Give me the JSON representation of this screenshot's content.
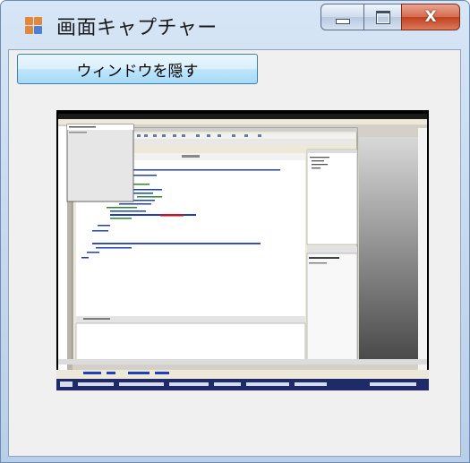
{
  "window": {
    "title": "画面キャプチャー",
    "app_icon": "app-window-icon",
    "minimize_icon": "minimize-icon",
    "maximize_icon": "maximize-icon",
    "close_icon": "close-icon",
    "close_glyph": "X"
  },
  "toolbar": {
    "hide_window_label": "ウィンドウを隠す"
  },
  "preview": {
    "description_icon": "captured-screen-thumbnail",
    "colors": {
      "background": "#000000",
      "ide_bg": "#ffffff",
      "ide_chrome": "#d4d0c8",
      "code_blue": "#1f3fbf",
      "code_green": "#2a8a2a",
      "highlight_red": "#c0182a",
      "taskbar": "#1f2a6b",
      "gray_panel": "#6f6f6f"
    }
  }
}
